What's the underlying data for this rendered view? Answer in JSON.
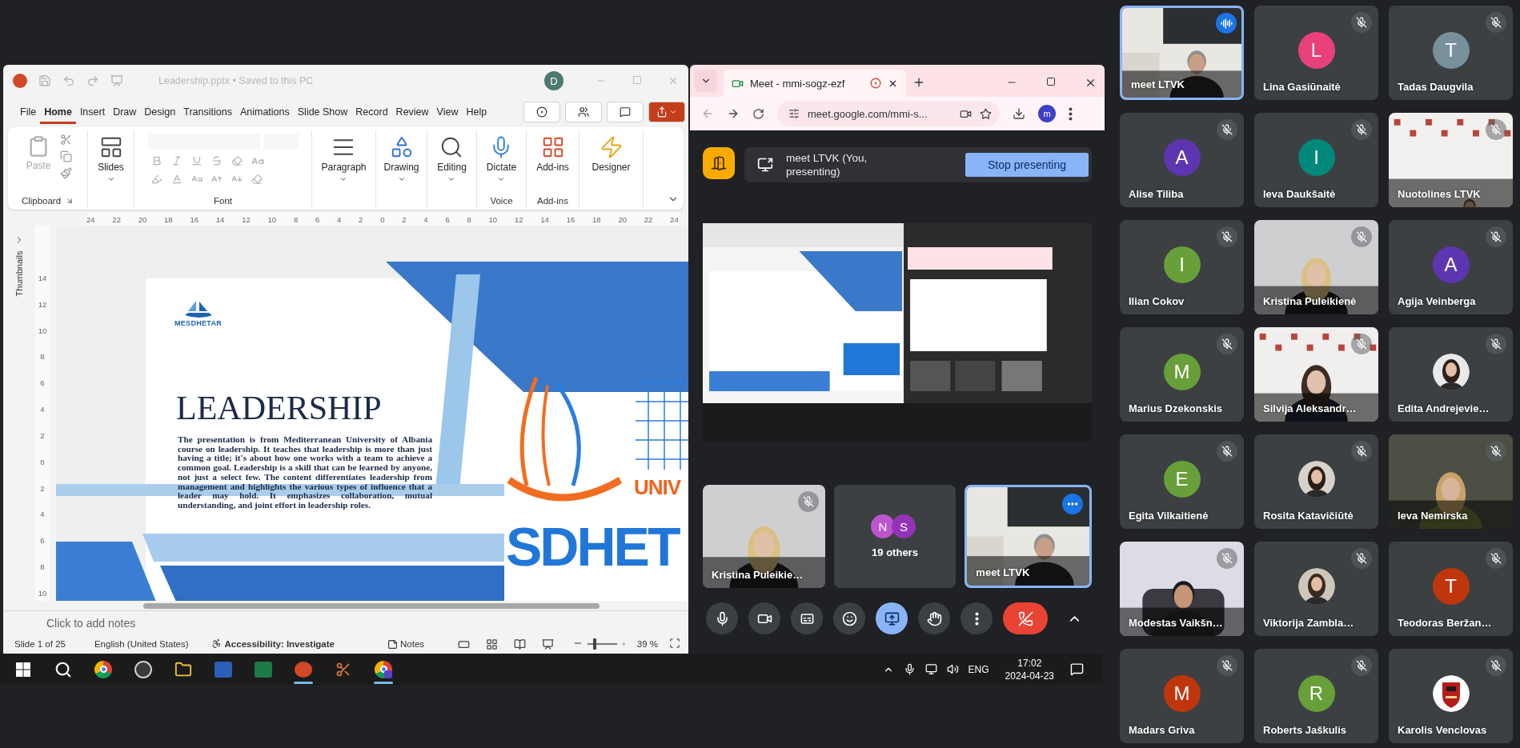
{
  "powerpoint": {
    "title": "Leadership.pptx • Saved to this PC",
    "account_initial": "D",
    "tabs": [
      {
        "label": "File",
        "selected": false
      },
      {
        "label": "Home",
        "selected": true
      },
      {
        "label": "Insert",
        "selected": false
      },
      {
        "label": "Draw",
        "selected": false
      },
      {
        "label": "Design",
        "selected": false
      },
      {
        "label": "Transitions",
        "selected": false
      },
      {
        "label": "Animations",
        "selected": false
      },
      {
        "label": "Slide Show",
        "selected": false
      },
      {
        "label": "Record",
        "selected": false
      },
      {
        "label": "Review",
        "selected": false
      },
      {
        "label": "View",
        "selected": false
      },
      {
        "label": "Help",
        "selected": false
      }
    ],
    "header_buttons": [
      {
        "kind": "record"
      },
      {
        "kind": "coauthor"
      },
      {
        "kind": "comment"
      },
      {
        "kind": "share"
      }
    ],
    "ribbon": [
      {
        "kind": "clipboard",
        "label": "Clipboard",
        "paste": {
          "label": "Paste",
          "disabled": true
        }
      },
      {
        "kind": "slides",
        "button": "Slides"
      },
      {
        "kind": "font",
        "label": "Font",
        "disabled": true
      },
      {
        "kind": "paragraph",
        "button": "Paragraph"
      },
      {
        "kind": "drawing",
        "button": "Drawing"
      },
      {
        "kind": "editing",
        "button": "Editing"
      },
      {
        "kind": "dictate",
        "button": "Dictate",
        "label": "Voice"
      },
      {
        "kind": "addins",
        "button": "Add-ins",
        "label": "Add-ins"
      },
      {
        "kind": "designer",
        "button": "Designer"
      }
    ],
    "ruler": [
      "24",
      "22",
      "20",
      "18",
      "16",
      "14",
      "12",
      "10",
      "8",
      "6",
      "4",
      "2",
      "0",
      "2",
      "4",
      "6",
      "8",
      "10",
      "12",
      "14",
      "16",
      "18",
      "20",
      "22",
      "24"
    ],
    "vertical_ruler": [
      "14",
      "12",
      "10",
      "8",
      "6",
      "4",
      "2",
      "0",
      "2",
      "4",
      "6",
      "8",
      "10"
    ],
    "thumbnails": "Thumbnails",
    "slide": {
      "logo": "MESDHETAR",
      "title": "LEADERSHIP",
      "body": "The presentation is from Mediterranean University of Albania course on leadership. It teaches that leadership is more than just having a title; it's about how one works with a team to achieve a common goal. Leadership is a skill that can be learned by anyone, not just a select few. The content differentiates leadership from management and highlights the various types of influence that a leader may hold. It emphasizes collaboration, mutual understanding, and joint effort in leadership roles.",
      "brand_top": "UNIV",
      "brand_bottom": "SDHET"
    },
    "notes": "Click to add notes",
    "status": {
      "slide": "Slide 1 of 25",
      "language": "English (United States)",
      "accessibility": "Accessibility: Investigate",
      "notes": "Notes",
      "zoom": "39 %",
      "zoom_slider": {
        "level": 0.2
      }
    }
  },
  "meet": {
    "tab_title": "Meet - mmi-sogz-ezf",
    "url": "meet.google.com/mmi-s...",
    "profile_initial": "m",
    "presenting": {
      "text": "meet LTVK (You, presenting)",
      "button": "Stop presenting"
    },
    "tiles": [
      {
        "kind": "video",
        "name": "Kristina Puleikie…",
        "muted": true,
        "highlighted": false
      },
      {
        "kind": "others",
        "label": "19 others",
        "initials": [
          {
            "letter": "N",
            "color": "#bd55cc"
          },
          {
            "letter": "S",
            "color": "#9334b8"
          }
        ]
      },
      {
        "kind": "video",
        "name": "meet LTVK",
        "muted": false,
        "highlighted": true
      }
    ],
    "controls": [
      {
        "kind": "mic",
        "active": false
      },
      {
        "kind": "camera",
        "active": false
      },
      {
        "kind": "captions",
        "active": false
      },
      {
        "kind": "emoji",
        "active": false
      },
      {
        "kind": "present",
        "active": true
      },
      {
        "kind": "hand",
        "active": false
      },
      {
        "kind": "more",
        "active": false
      },
      {
        "kind": "hangup",
        "active": false
      },
      {
        "kind": "chevron",
        "active": false
      }
    ]
  },
  "taskbar": {
    "apps": [
      {
        "kind": "start",
        "running": false
      },
      {
        "kind": "search",
        "running": false
      },
      {
        "kind": "browser",
        "running": false
      },
      {
        "kind": "recorder",
        "running": false
      },
      {
        "kind": "folder",
        "running": false
      },
      {
        "kind": "document",
        "running": false
      },
      {
        "kind": "spreadsheet",
        "running": false
      },
      {
        "kind": "presentation",
        "running": true
      },
      {
        "kind": "snip",
        "running": false
      },
      {
        "kind": "browser_profile",
        "running": true
      }
    ],
    "language": "ENG",
    "time": "17:02",
    "date": "2024-04-23"
  },
  "participants": [
    {
      "name": "meet LTVK",
      "kind": "video",
      "muted": false,
      "speaking": true
    },
    {
      "name": "Lina Gasiūnaitė",
      "kind": "avatar",
      "initial": "L",
      "color": "#e8407a",
      "muted": true,
      "speaking": false
    },
    {
      "name": "Tadas Daugvila",
      "kind": "avatar",
      "initial": "T",
      "color": "#78909c",
      "muted": true,
      "speaking": false
    },
    {
      "name": "Alise Tiliba",
      "kind": "avatar",
      "initial": "A",
      "color": "#5e35b1",
      "muted": true,
      "speaking": false
    },
    {
      "name": "Ieva Daukšaitė",
      "kind": "avatar",
      "initial": "I",
      "color": "#00897b",
      "muted": true,
      "speaking": false
    },
    {
      "name": "Nuotolines LTVK",
      "kind": "video",
      "muted": true,
      "speaking": false
    },
    {
      "name": "Ilian Cokov",
      "kind": "avatar",
      "initial": "I",
      "color": "#689f38",
      "muted": true,
      "speaking": false
    },
    {
      "name": "Kristina Puleikienė",
      "kind": "video",
      "muted": true,
      "speaking": false
    },
    {
      "name": "Agija Veinberga",
      "kind": "avatar",
      "initial": "A",
      "color": "#5e35b1",
      "muted": true,
      "speaking": false
    },
    {
      "name": "Marius Dzekonskis",
      "kind": "avatar",
      "initial": "M",
      "color": "#689f38",
      "muted": true,
      "speaking": false
    },
    {
      "name": "Silvija Aleksandr…",
      "kind": "video",
      "muted": true,
      "speaking": false
    },
    {
      "name": "Edita Andrejevie…",
      "muted": true,
      "speaking": false
    },
    {
      "name": "Egita Vilkaitienė",
      "kind": "avatar",
      "initial": "E",
      "color": "#689f38",
      "muted": true,
      "speaking": false
    },
    {
      "name": "Rosita Katavičiūtė",
      "muted": true,
      "speaking": false
    },
    {
      "name": "Ieva Nemirska",
      "kind": "video",
      "muted": true,
      "speaking": false
    },
    {
      "name": "Modestas Vaikšn…",
      "kind": "video",
      "muted": true,
      "speaking": false
    },
    {
      "name": "Viktorija Zambla…",
      "muted": true,
      "speaking": false
    },
    {
      "name": "Teodoras Beržan…",
      "kind": "avatar",
      "initial": "T",
      "color": "#bf360c",
      "muted": true,
      "speaking": false
    },
    {
      "name": "Madars Griva",
      "kind": "avatar",
      "initial": "M",
      "color": "#bf360c",
      "muted": true,
      "speaking": false
    },
    {
      "name": "Roberts Jaškulis",
      "kind": "avatar",
      "initial": "R",
      "color": "#689f38",
      "muted": true,
      "speaking": false
    },
    {
      "name": "Karolis Venclovas",
      "muted": true,
      "speaking": false
    }
  ]
}
